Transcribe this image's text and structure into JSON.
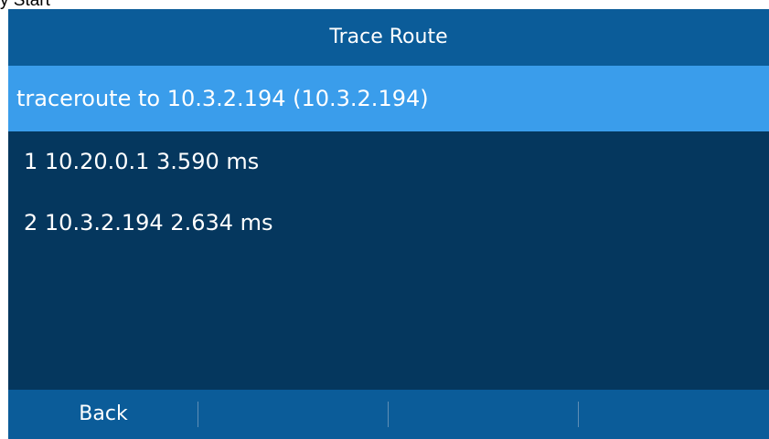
{
  "window": {
    "caption_fragment": "y Start"
  },
  "screen": {
    "title": "Trace Route",
    "rows": [
      {
        "text": "traceroute to 10.3.2.194 (10.3.2.194)",
        "selected": true
      },
      {
        "text": "1  10.20.0.1  3.590 ms",
        "selected": false
      },
      {
        "text": "2  10.3.2.194  2.634 ms",
        "selected": false
      }
    ],
    "softkeys": [
      {
        "label": "Back"
      },
      {
        "label": ""
      },
      {
        "label": ""
      },
      {
        "label": ""
      }
    ]
  },
  "colors": {
    "screen_background": "#05375e",
    "bar_background": "#0b5c99",
    "selected_row": "#3a9deb",
    "text": "#ffffff"
  }
}
